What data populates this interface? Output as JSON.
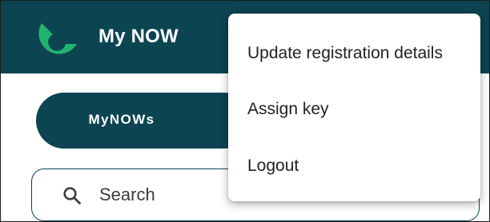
{
  "app": {
    "title": "My NOW",
    "logo_icon": "now-logo-icon",
    "brand_color": "#0c4452",
    "logo_color": "#21b46e"
  },
  "tabs": {
    "active_label": "MyNOWs"
  },
  "search": {
    "icon": "search-icon",
    "placeholder": "Search"
  },
  "menu": {
    "items": [
      {
        "label": "Update registration details"
      },
      {
        "label": "Assign key"
      },
      {
        "label": "Logout"
      }
    ]
  }
}
